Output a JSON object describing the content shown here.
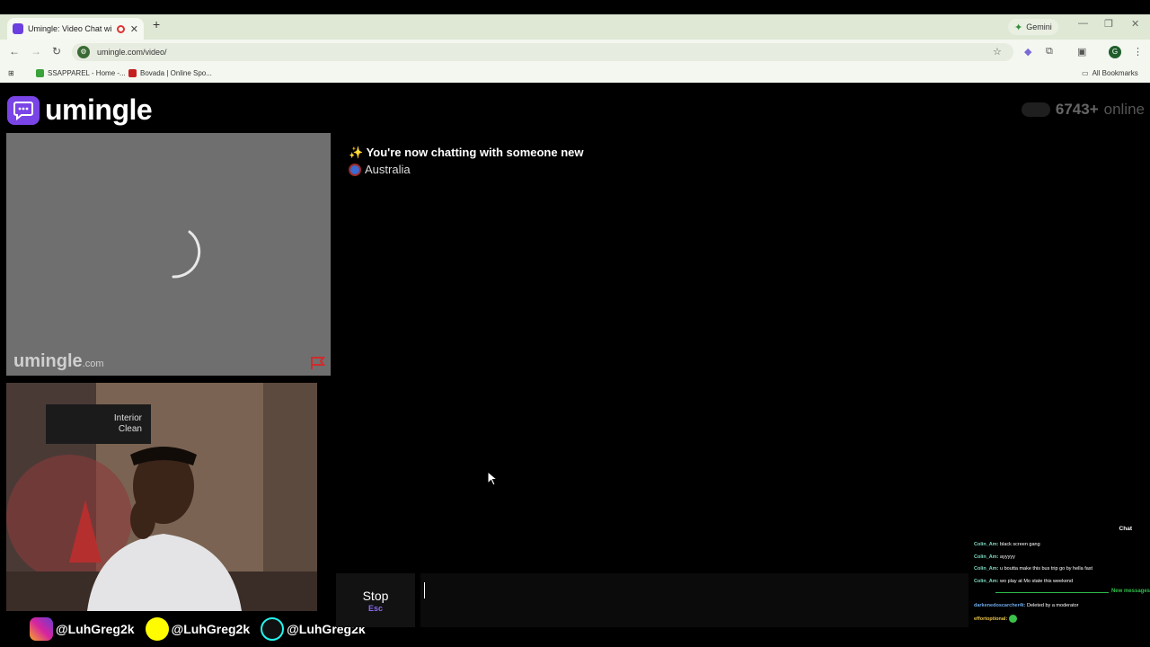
{
  "browser": {
    "tab_title": "Umingle: Video Chat with S",
    "new_tab": "+",
    "gemini_label": "Gemini",
    "url": "umingle.com/video/",
    "bookmarks": [
      {
        "label": "SSAPPAREL - Home -...",
        "color": "#3aa23a"
      },
      {
        "label": "Bovada | Online Spo...",
        "color": "#c42020"
      }
    ],
    "all_bookmarks": "All Bookmarks",
    "profile_initial": "G"
  },
  "header": {
    "brand": "umingle",
    "online_count": "6743+",
    "online_label": "online"
  },
  "stranger_video": {
    "watermark": "umingle",
    "watermark_suffix": ".com"
  },
  "self_video": {
    "sign_line1": "Interior",
    "sign_line2": "Clean"
  },
  "socials": [
    {
      "platform": "instagram",
      "handle": "@LuhGreg2k",
      "color": "#d6249f"
    },
    {
      "platform": "snapchat",
      "handle": "@LuhGreg2k",
      "color": "#fffc00"
    },
    {
      "platform": "tiktok",
      "handle": "@LuhGreg2k",
      "color": "#111111"
    }
  ],
  "chat": {
    "status_line": "✨ You're now chatting with someone new",
    "country": "Australia"
  },
  "stream_overlay": {
    "title": "Chat",
    "messages": [
      {
        "user": "Colin_Am:",
        "text": "black screen gang"
      },
      {
        "user": "Colin_Am:",
        "text": "ayyyyy"
      },
      {
        "user": "Colin_Am:",
        "text": "u boutta make this bus trip go by hella fast"
      },
      {
        "user": "Colin_Am:",
        "text": "wo play at Mo state this weekend"
      }
    ],
    "new_messages_label": "New messages",
    "later_messages": [
      {
        "user": "darkenedoscarcher4t:",
        "text": "Deleted by a moderator"
      },
      {
        "user": "effortoptional:",
        "text": ""
      }
    ]
  },
  "controls": {
    "stop_label": "Stop",
    "stop_shortcut": "Esc",
    "message_value": ""
  }
}
